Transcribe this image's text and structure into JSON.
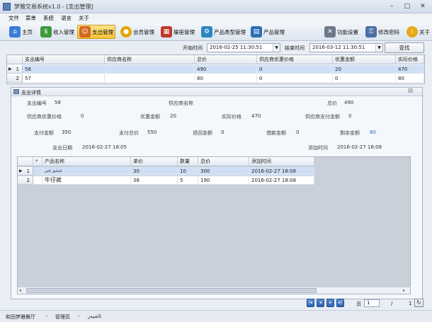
{
  "window": {
    "title": "梦雅交易系统v1.0 - [支出管理]"
  },
  "menu": [
    "文件",
    "菜单",
    "系统",
    "语言",
    "关于"
  ],
  "toolbar": [
    {
      "label": "主页",
      "icon": "home-icon",
      "color": "#3b7dd8"
    },
    {
      "label": "收入管理",
      "icon": "money-icon",
      "color": "#3c9a3c"
    },
    {
      "label": "支出管理",
      "icon": "user-expense-icon",
      "color": "#d2691e",
      "active": true
    },
    {
      "label": "会员管理",
      "icon": "member-icon",
      "color": "#e0a800"
    },
    {
      "label": "碟座管理",
      "icon": "table-icon",
      "color": "#c0392b"
    },
    {
      "label": "产品类型管理",
      "icon": "gear-icon",
      "color": "#2e86c1"
    },
    {
      "label": "产品管理",
      "icon": "product-icon",
      "color": "#2c6fb5"
    },
    {
      "label": "功能设置",
      "icon": "tools-icon",
      "color": "#6c7a89"
    },
    {
      "label": "修改密码",
      "icon": "lock-icon",
      "color": "#4a6fa5"
    },
    {
      "label": "关于",
      "icon": "info-icon",
      "color": "#e6a817"
    }
  ],
  "search": {
    "start_label": "开始时间",
    "start_value": "2016-02-25 11:30:51",
    "end_label": "结束时间",
    "end_value": "2016-03-12 11:30:51",
    "button": "查找"
  },
  "expense_grid": {
    "columns": [
      "支出编号",
      "供应商名称",
      "总价",
      "供应商优惠价格",
      "优惠金额",
      "实际价格"
    ],
    "rows": [
      {
        "num": "1",
        "cells": [
          "58",
          "",
          "490",
          "0",
          "20",
          "470"
        ]
      },
      {
        "num": "2",
        "cells": [
          "57",
          "",
          "80",
          "0",
          "0",
          "80"
        ]
      }
    ]
  },
  "detail": {
    "title": "支出详情",
    "fields": {
      "expense_no_label": "支出编号",
      "expense_no": "58",
      "supplier_label": "供应商名称",
      "supplier": "",
      "total_label": "总价",
      "total": "490",
      "supplier_discount_label": "供应商优惠价格",
      "supplier_discount": "0",
      "discount_amount_label": "优惠金额",
      "discount_amount": "20",
      "actual_price_label": "实际价格",
      "actual_price": "470",
      "supplier_paid_label": "供应商支付金额",
      "supplier_paid": "0",
      "paid_label": "支付金额",
      "paid": "350",
      "pay_total_label": "支付总价",
      "pay_total": "550",
      "refund_label": "退回金额",
      "refund": "0",
      "borrow_label": "借款金额",
      "borrow": "0",
      "remaining_label": "剩余金额",
      "remaining": "80",
      "date_label": "支出日期",
      "date": "2016-02-27 18:05",
      "added_label": "添加时间",
      "added": "2016-02-27 18:08"
    },
    "items_grid": {
      "columns": [
        "*",
        "产品名称",
        "单价",
        "数量",
        "总价",
        "添加时间"
      ],
      "rows": [
        {
          "num": "1",
          "cells": [
            "",
            "ئاشلىق ئاش",
            "30",
            "10",
            "300",
            "2016-02-27 18:08"
          ]
        },
        {
          "num": "2",
          "cells": [
            "",
            "牛仔裤",
            "38",
            "5",
            "190",
            "2016-02-27 18:08"
          ]
        }
      ]
    }
  },
  "pager": {
    "page_label": "页",
    "page": "1",
    "total": "/",
    "count": "1"
  },
  "status": {
    "shop": "和田梦雅餐厅",
    "sep1": "-",
    "role": "管理员",
    "sep2": "-",
    "user": "ئاشپەز"
  },
  "colors": {
    "selected_row": "#cfe0f6",
    "accent": "#2f64b0"
  }
}
